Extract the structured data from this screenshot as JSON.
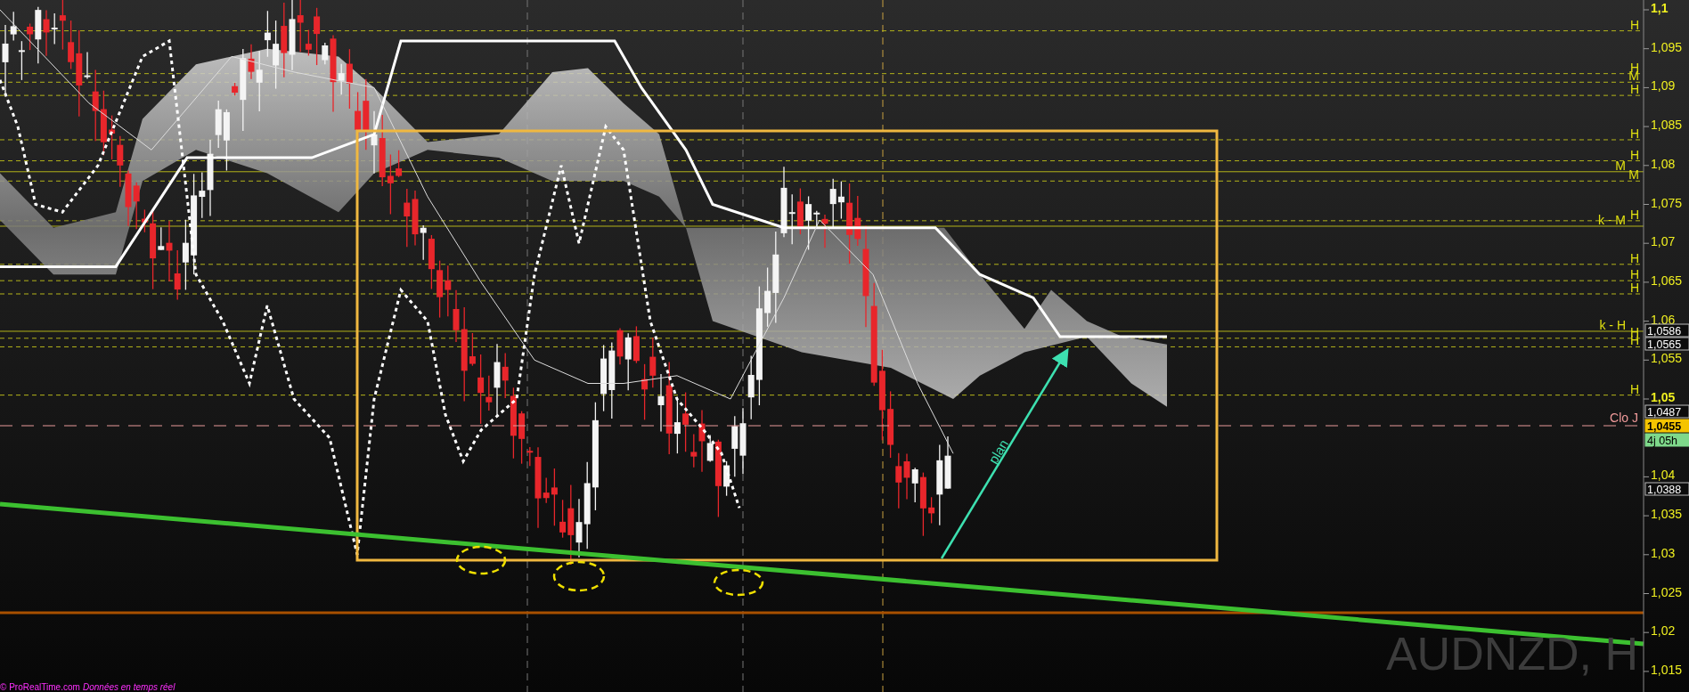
{
  "price_axis": {
    "ticks": [
      {
        "label": "1,1",
        "major": true
      },
      {
        "label": "1,095",
        "major": false
      },
      {
        "label": "1,09",
        "major": false
      },
      {
        "label": "1,085",
        "major": false
      },
      {
        "label": "1,08",
        "major": false
      },
      {
        "label": "1,075",
        "major": false
      },
      {
        "label": "1,07",
        "major": false
      },
      {
        "label": "1,065",
        "major": false
      },
      {
        "label": "1,06",
        "major": false
      },
      {
        "label": "1,055",
        "major": false
      },
      {
        "label": "1,05",
        "major": true
      },
      {
        "label": "1,04",
        "major": false
      },
      {
        "label": "1,035",
        "major": false
      },
      {
        "label": "1,03",
        "major": false
      },
      {
        "label": "1,025",
        "major": false
      },
      {
        "label": "1,02",
        "major": false
      },
      {
        "label": "1,015",
        "major": false
      }
    ]
  },
  "levels": [
    {
      "label": "H",
      "kind": "dashed"
    },
    {
      "label": "H",
      "kind": "dashed"
    },
    {
      "label": "M",
      "kind": "dashed"
    },
    {
      "label": "H",
      "kind": "dashed"
    },
    {
      "label": "H",
      "kind": "dashed"
    },
    {
      "label": "H",
      "kind": "dashed"
    },
    {
      "label": "M",
      "kind": "solid"
    },
    {
      "label": "M",
      "kind": "dashed"
    },
    {
      "label": "H",
      "kind": "dashed"
    },
    {
      "label": "k - M",
      "kind": "solid"
    },
    {
      "label": "H",
      "kind": "dashed"
    },
    {
      "label": "H",
      "kind": "dashed"
    },
    {
      "label": "H",
      "kind": "dashed"
    },
    {
      "label": "k - H",
      "kind": "solid"
    },
    {
      "label": "H",
      "kind": "dashed"
    },
    {
      "label": "H",
      "kind": "dashed"
    },
    {
      "label": "H",
      "kind": "dashed"
    }
  ],
  "price_tags": [
    {
      "text": "1,0586",
      "kind": "level"
    },
    {
      "text": "1,0565",
      "kind": "level"
    },
    {
      "text": "1,0487",
      "kind": "level"
    },
    {
      "text": "1,0455",
      "kind": "last"
    },
    {
      "text": "4j 05h",
      "kind": "timer"
    },
    {
      "text": "1,0388",
      "kind": "level"
    }
  ],
  "close_marker": {
    "label": "Clo J"
  },
  "trend_arrow": {
    "label": "plan"
  },
  "symbol": "AUDNZD, H",
  "footer": {
    "copyright": "© ProRealTime.com",
    "status": "Données en temps réel"
  }
}
